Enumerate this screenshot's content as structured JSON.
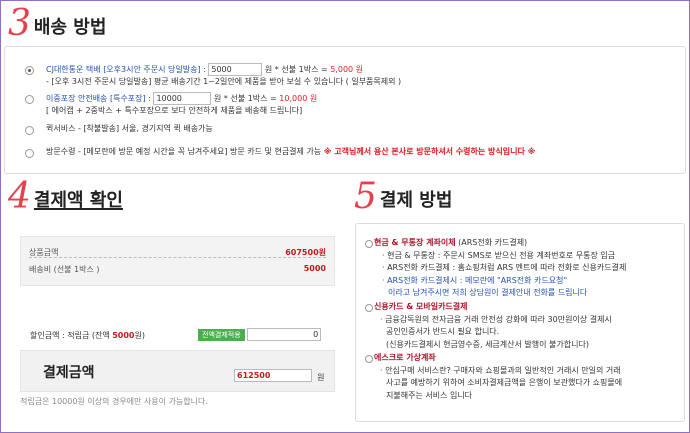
{
  "delivery": {
    "number": "3",
    "title": "배송 방법",
    "options": [
      {
        "selected": true,
        "name": "CJ대한통운 택배 [오후3시안 주문시 당일발송] :",
        "fee": "5000",
        "unit_text": "원 * 선불 1박스 =",
        "total": "5,000 원",
        "desc": "- [오후 3시전 주문시 당일발송] 평균 배송기간 1~2일안에 제품을 받아 보실 수 있습니다 ( 일부품목제외 )"
      },
      {
        "selected": false,
        "name": "이중포장 안전배송 [특수포장] :",
        "fee": "10000",
        "unit_text": "원 * 선불 1박스 =",
        "total": "10,000 원",
        "desc": "[ 에어캡 + 2중박스 + 특수포장으로 보다 안전하게 제품을 배송해 드립니다]"
      },
      {
        "selected": false,
        "name": "퀵서비스 - [착불발송] 서울, 경기지역 퀵 배송가능"
      },
      {
        "selected": false,
        "name": "방문수령 - [메모란에 방문 예정 시간을 꼭 남겨주세요] 방문 카드 및 현금결제 가능",
        "note": "※ 고객님께서 용산 본사로 방문하셔서 수령하는 방식입니다 ※"
      }
    ]
  },
  "confirm": {
    "number": "4",
    "title": "결제액 확인",
    "product_label": "상품금액",
    "product_value": "607500원",
    "shipping_label": "배송비 (선불 1박스 )",
    "shipping_value": "5000",
    "discount_label_pre": "할인금액 : 적립금 (잔액",
    "discount_balance": "5000",
    "discount_label_post": "원)",
    "apply_button": "전액결제적용",
    "discount_value": "0",
    "final_label": "결제금액",
    "final_value": "612500",
    "final_unit": "원",
    "note": "적립금은 10000원 이상의 경우에만 사용이 가능합니다."
  },
  "payment": {
    "number": "5",
    "title": "결제 방법",
    "methods": [
      {
        "name": "현금 & 무통장 계좌이체",
        "suffix": "(ARS전화 카드결제)",
        "lines": [
          "· 현금 & 무통장 : 주문시 SMS로 받으신 전용 계좌번호로 무통장 입금",
          "· ARS전화 카드결제 : 홈쇼핑처럼 ARS 멘트에 따라 전화로 신용카드결제"
        ],
        "blue_line": "· ARS전화 카드결제시 : 메모란에 \"ARS전화 카드요청\"",
        "blue_line2": "이라고 남겨주시면 저희 상담원이 결제안내 전화를 드립니다"
      },
      {
        "name": "신용카드 & 모바일카드결제",
        "lines": [
          "· 금융감독원의 전자금융 거래 안전성 강화에 따라 30만원이상 결제시",
          "공인인증서가 반드시 필요 합니다.",
          "(신용카드결제시 현금영수증, 세금계산서 발행이 불가합니다)"
        ]
      },
      {
        "name": "에스크로 가상계좌",
        "lines": [
          "· 안심구매 서비스란? 구매자와 쇼핑몰과의 일반적인 거래시 만일의 거래",
          "사고를 예방하기 위하여 소비자결제금액을 은행이 보관했다가 쇼핑몰에",
          "지불해주는 서비스 입니다"
        ]
      }
    ]
  },
  "colors": {
    "accent_red": "#e8404a",
    "link_blue": "#2452b3",
    "frame": "#8f6fc8",
    "apply_green": "#4cae4c"
  }
}
